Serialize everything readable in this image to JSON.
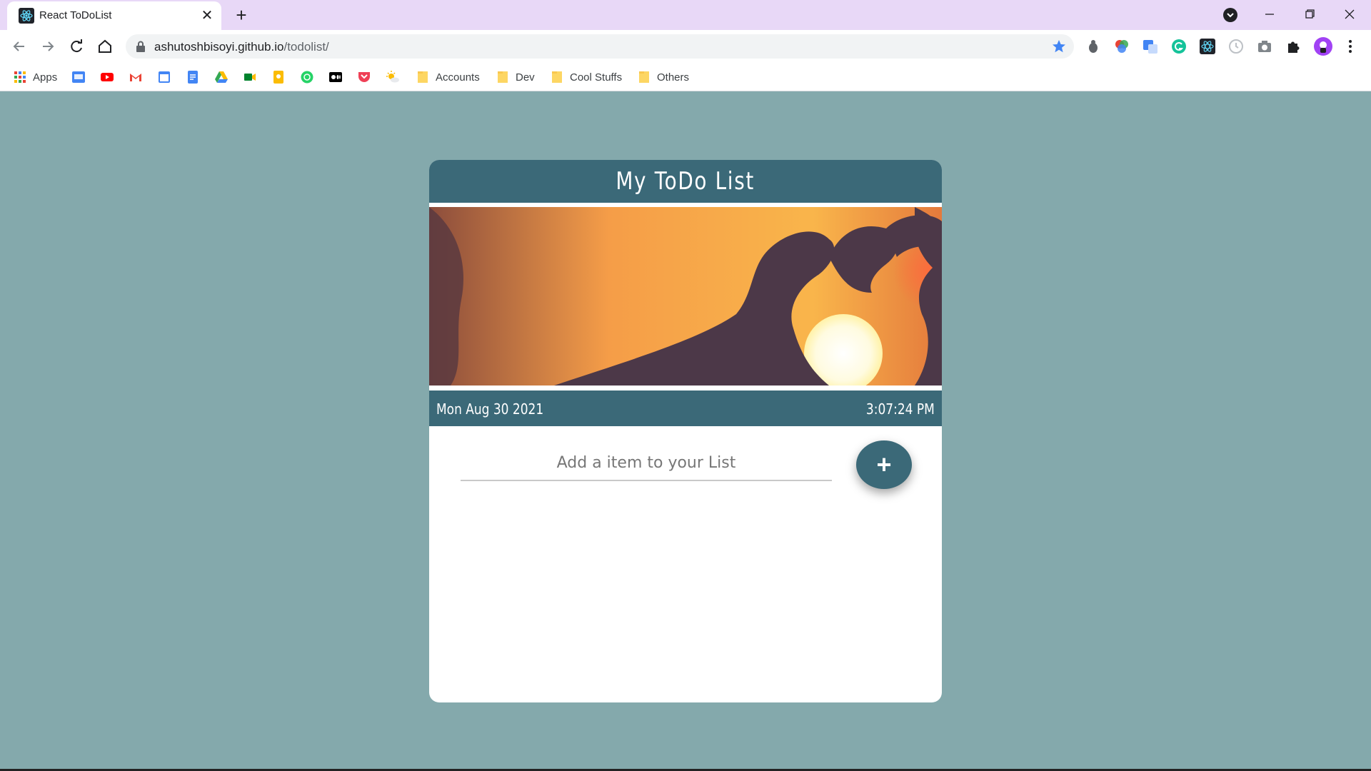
{
  "browser": {
    "tab_title": "React ToDoList",
    "new_tab_label": "+",
    "url_host": "ashutoshbisoyi.github.io",
    "url_path": "/todolist/",
    "bookmarks": [
      {
        "label": "Apps",
        "icon": "apps-grid-icon"
      },
      {
        "label": "Accounts",
        "icon": "folder-icon"
      },
      {
        "label": "Dev",
        "icon": "folder-icon"
      },
      {
        "label": "Cool Stuffs",
        "icon": "folder-icon"
      },
      {
        "label": "Others",
        "icon": "folder-icon"
      }
    ]
  },
  "app": {
    "title": "My ToDo List",
    "date": "Mon Aug 30 2021",
    "time": "3:07:24 PM",
    "input_placeholder": "Add a item to your List",
    "input_value": "",
    "add_button_label": "+",
    "items": []
  },
  "colors": {
    "page_background": "#84a9ac",
    "accent": "#3b6978",
    "tab_strip": "#e8d8f7",
    "card_background": "#ffffff"
  }
}
